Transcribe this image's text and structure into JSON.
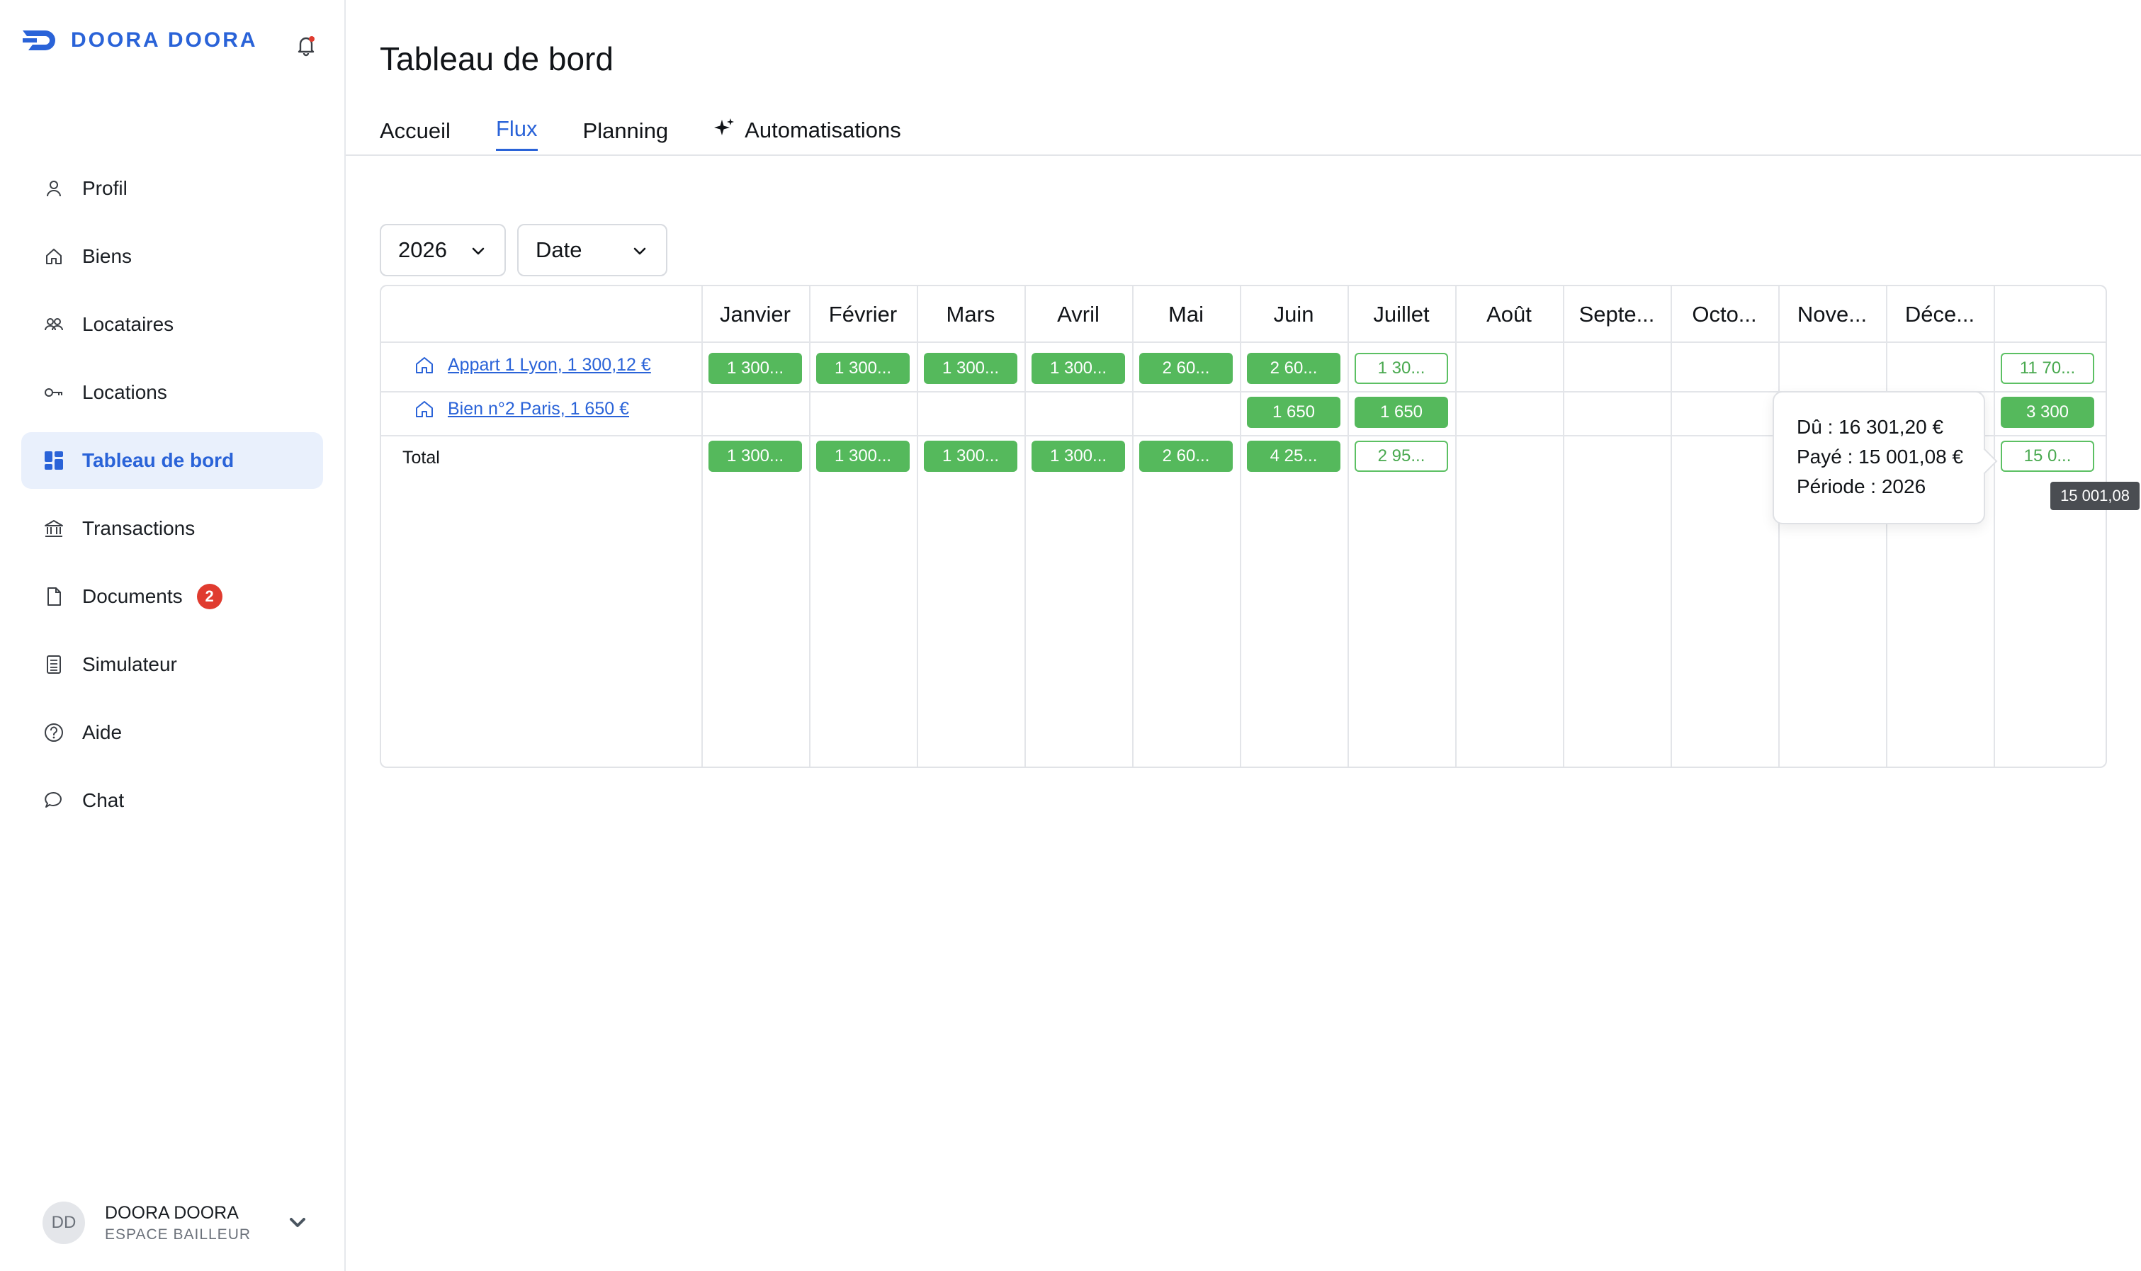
{
  "brand": {
    "name": "DOORA DOORA",
    "color": "#2a63d8"
  },
  "header": {
    "notifications_icon": "bell-icon"
  },
  "sidebar": {
    "items": [
      {
        "label": "Profil",
        "icon": "user-icon",
        "active": false
      },
      {
        "label": "Biens",
        "icon": "home-icon",
        "active": false
      },
      {
        "label": "Locataires",
        "icon": "users-icon",
        "active": false
      },
      {
        "label": "Locations",
        "icon": "key-icon",
        "active": false
      },
      {
        "label": "Tableau de bord",
        "icon": "dashboard-icon",
        "active": true
      },
      {
        "label": "Transactions",
        "icon": "bank-icon",
        "active": false
      },
      {
        "label": "Documents",
        "icon": "document-icon",
        "active": false,
        "badge": "2"
      },
      {
        "label": "Simulateur",
        "icon": "calculator-icon",
        "active": false
      },
      {
        "label": "Aide",
        "icon": "help-icon",
        "active": false
      },
      {
        "label": "Chat",
        "icon": "chat-icon",
        "active": false
      }
    ],
    "user": {
      "initials": "DD",
      "name": "DOORA DOORA",
      "role": "ESPACE BAILLEUR"
    }
  },
  "main": {
    "title": "Tableau de bord",
    "tabs": [
      {
        "label": "Accueil",
        "active": false
      },
      {
        "label": "Flux",
        "active": true
      },
      {
        "label": "Planning",
        "active": false
      },
      {
        "label": "Automatisations",
        "active": false,
        "icon": "sparkle-icon"
      }
    ],
    "filters": {
      "year": "2026",
      "sort": "Date"
    },
    "months": [
      "Janvier",
      "Février",
      "Mars",
      "Avril",
      "Mai",
      "Juin",
      "Juillet",
      "Août",
      "Septe...",
      "Octo...",
      "Nove...",
      "Déce..."
    ],
    "rows": [
      {
        "label": "Appart 1 Lyon, 1 300,12 €",
        "cells": [
          {
            "text": "1 300...",
            "status": "full"
          },
          {
            "text": "1 300...",
            "status": "full"
          },
          {
            "text": "1 300...",
            "status": "full"
          },
          {
            "text": "1 300...",
            "status": "full"
          },
          {
            "text": "2 60...",
            "status": "full"
          },
          {
            "text": "2 60...",
            "status": "full"
          },
          {
            "text": "1 30...",
            "status": "partial"
          },
          null,
          null,
          null,
          null,
          null
        ],
        "total": {
          "text": "11 70...",
          "status": "partial"
        }
      },
      {
        "label": "Bien n°2 Paris, 1 650 €",
        "cells": [
          null,
          null,
          null,
          null,
          null,
          {
            "text": "1 650",
            "status": "full"
          },
          {
            "text": "1 650",
            "status": "full"
          },
          null,
          null,
          null,
          null,
          null
        ],
        "total": {
          "text": "3 300",
          "status": "full"
        }
      }
    ],
    "total_row": {
      "label": "Total",
      "cells": [
        {
          "text": "1 300...",
          "status": "full"
        },
        {
          "text": "1 300...",
          "status": "full"
        },
        {
          "text": "1 300...",
          "status": "full"
        },
        {
          "text": "1 300...",
          "status": "full"
        },
        {
          "text": "2 60...",
          "status": "full"
        },
        {
          "text": "4 25...",
          "status": "full"
        },
        {
          "text": "2 95...",
          "status": "partial"
        },
        null,
        null,
        null,
        null,
        null
      ],
      "total": {
        "text": "15 0...",
        "status": "partial"
      }
    },
    "tooltip": {
      "due": "Dû : 16 301,20 €",
      "paid": "Payé : 15 001,08 €",
      "period": "Période : 2026"
    },
    "hover_value": "15 001,08"
  },
  "colors": {
    "accent": "#2a63d8",
    "paid": "#55b95c",
    "badge": "#e03b2f",
    "active_bg": "#e9f0fc"
  }
}
